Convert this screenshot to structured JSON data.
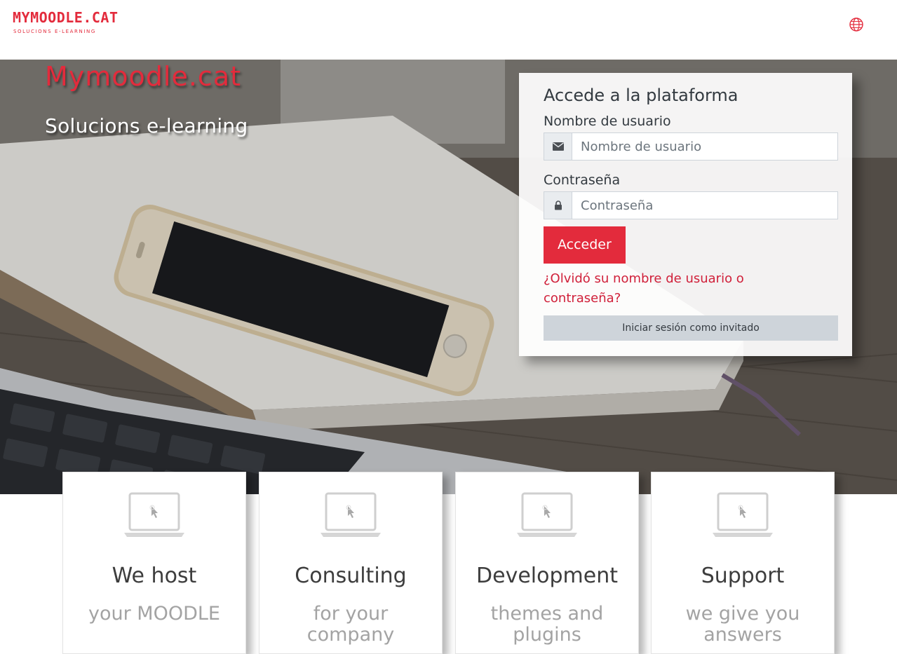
{
  "header": {
    "logo_main": "MYMOODLE.CAT",
    "logo_sub": "SOLUCIONS E-LEARNING",
    "language_icon": "globe-icon"
  },
  "hero": {
    "title": "Mymoodle.cat",
    "subtitle": "Solucions e-learning"
  },
  "login": {
    "title": "Accede a la plataforma",
    "username_label": "Nombre de usuario",
    "username_placeholder": "Nombre de usuario",
    "username_value": "",
    "username_icon": "envelope-icon",
    "password_label": "Contraseña",
    "password_placeholder": "Contraseña",
    "password_value": "",
    "password_icon": "lock-icon",
    "submit_label": "Acceder",
    "forgot_link": "¿Olvidó su nombre de usuario o contraseña?",
    "guest_button": "Iniciar sesión como invitado"
  },
  "features": [
    {
      "icon": "laptop-icon",
      "title": "We host",
      "text": "your MOODLE"
    },
    {
      "icon": "laptop-icon",
      "title": "Consulting",
      "text": "for your company"
    },
    {
      "icon": "laptop-icon",
      "title": "Development",
      "text": "themes and plugins"
    },
    {
      "icon": "laptop-icon",
      "title": "Support",
      "text": "we give you answers"
    }
  ],
  "colors": {
    "brand": "#e32b3c",
    "guest_button": "#ced4da",
    "card_title": "#3d3d3d",
    "card_text": "#a3a3a3"
  }
}
